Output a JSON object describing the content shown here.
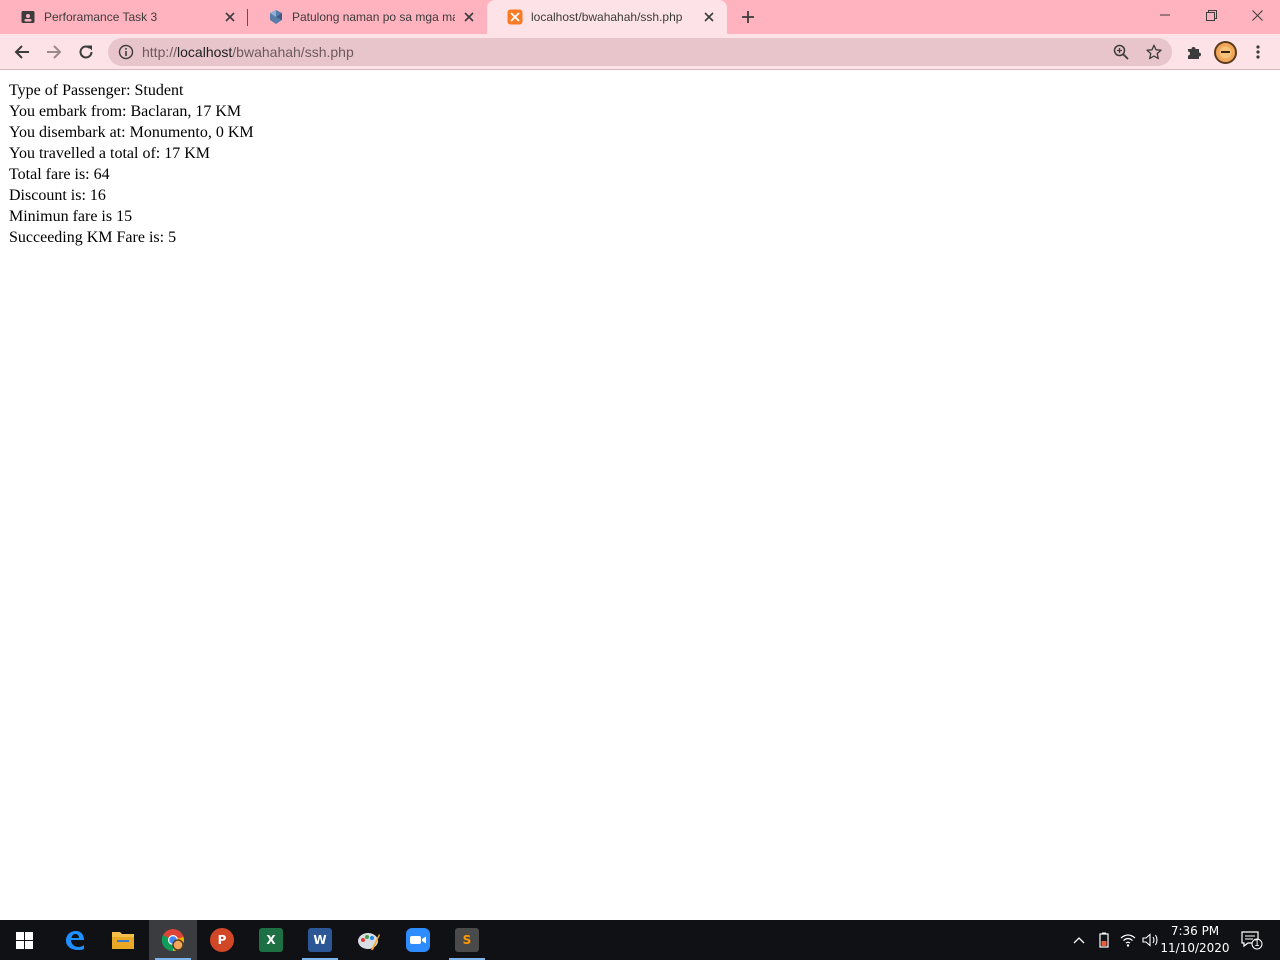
{
  "browser": {
    "tabs": [
      {
        "title": "Perforamance Task 3",
        "favicon": "classroom-icon",
        "active": false
      },
      {
        "title": "Patulong naman po sa mga mast",
        "favicon": "brainly-icon",
        "active": false
      },
      {
        "title": "localhost/bwahahah/ssh.php",
        "favicon": "xampp-icon",
        "active": true
      }
    ],
    "address_bar": {
      "scheme": "http://",
      "host": "localhost",
      "path": "/bwahahah/ssh.php"
    }
  },
  "page": {
    "lines": [
      "Type of Passenger: Student",
      "You embark from: Baclaran, 17 KM",
      "You disembark at: Monumento, 0 KM",
      "You travelled a total of: 17 KM",
      "Total fare is: 64",
      "Discount is: 16",
      "Minimun fare is 15",
      "Succeeding KM Fare is: 5"
    ]
  },
  "taskbar": {
    "apps": [
      {
        "name": "edge",
        "icon": "edge-icon"
      },
      {
        "name": "file-explorer",
        "icon": "folder-icon"
      },
      {
        "name": "chrome",
        "icon": "chrome-icon",
        "active": true
      },
      {
        "name": "powerpoint",
        "icon": "powerpoint-icon",
        "letter": "P"
      },
      {
        "name": "excel",
        "icon": "excel-icon",
        "letter": "X"
      },
      {
        "name": "word",
        "icon": "word-icon",
        "letter": "W"
      },
      {
        "name": "paint",
        "icon": "paint-icon"
      },
      {
        "name": "zoom",
        "icon": "zoom-icon"
      },
      {
        "name": "sublime-text",
        "icon": "sublime-icon",
        "letter": "S"
      }
    ],
    "clock": {
      "time": "7:36 PM",
      "date": "11/10/2020"
    },
    "notification_count": "1"
  },
  "colors": {
    "tabstrip": "#ffb3bf",
    "toolbar": "#fde3e7",
    "omnibox": "#e8c5cb",
    "taskbar": "#101115"
  }
}
